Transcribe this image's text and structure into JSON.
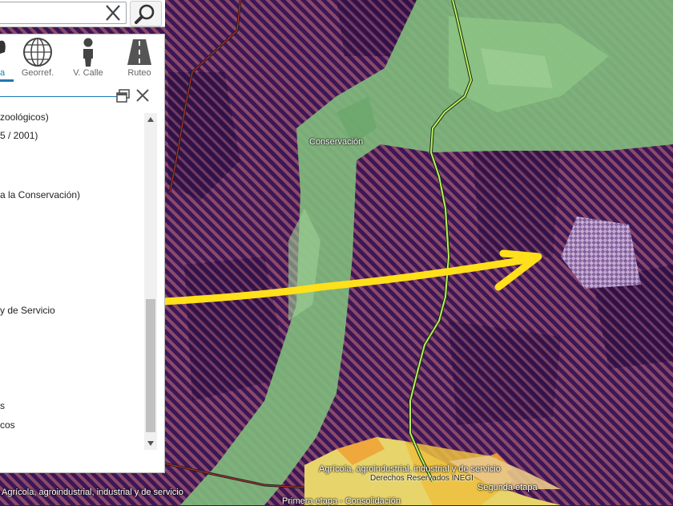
{
  "search": {
    "placeholder": "",
    "value": ""
  },
  "toolbar": {
    "tools": [
      {
        "label": "a",
        "icon": "layers-icon",
        "active": true
      },
      {
        "label": "Georref.",
        "icon": "globe-icon"
      },
      {
        "label": "V. Calle",
        "icon": "person-icon"
      },
      {
        "label": "Ruteo",
        "icon": "road-icon"
      }
    ]
  },
  "layers": [
    "zoológicos)",
    "5 / 2001)",
    "a la Conservación)",
    "y de Servicio",
    "s",
    "cos"
  ],
  "map": {
    "labels": {
      "conservacion": "Conservación",
      "agricola_right": "Agrícola, agroindustrial, industrial y de servicio",
      "derechos": "Derechos Reservados INEGI",
      "segunda_etapa": "Segunda etapa",
      "agricola_left": "Agrícola, agroindustrial, industrial y de servicio",
      "primera_etapa": "Primera etapa - Consolidación"
    }
  },
  "colors": {
    "zone_purple": "#4a1f63",
    "stripe_orange": "#c07a3a",
    "conservation_green": "#7fba7c",
    "road_green": "#b8f060",
    "annotation_yellow": "#ffe01a",
    "accent_blue": "#1e78b4"
  }
}
